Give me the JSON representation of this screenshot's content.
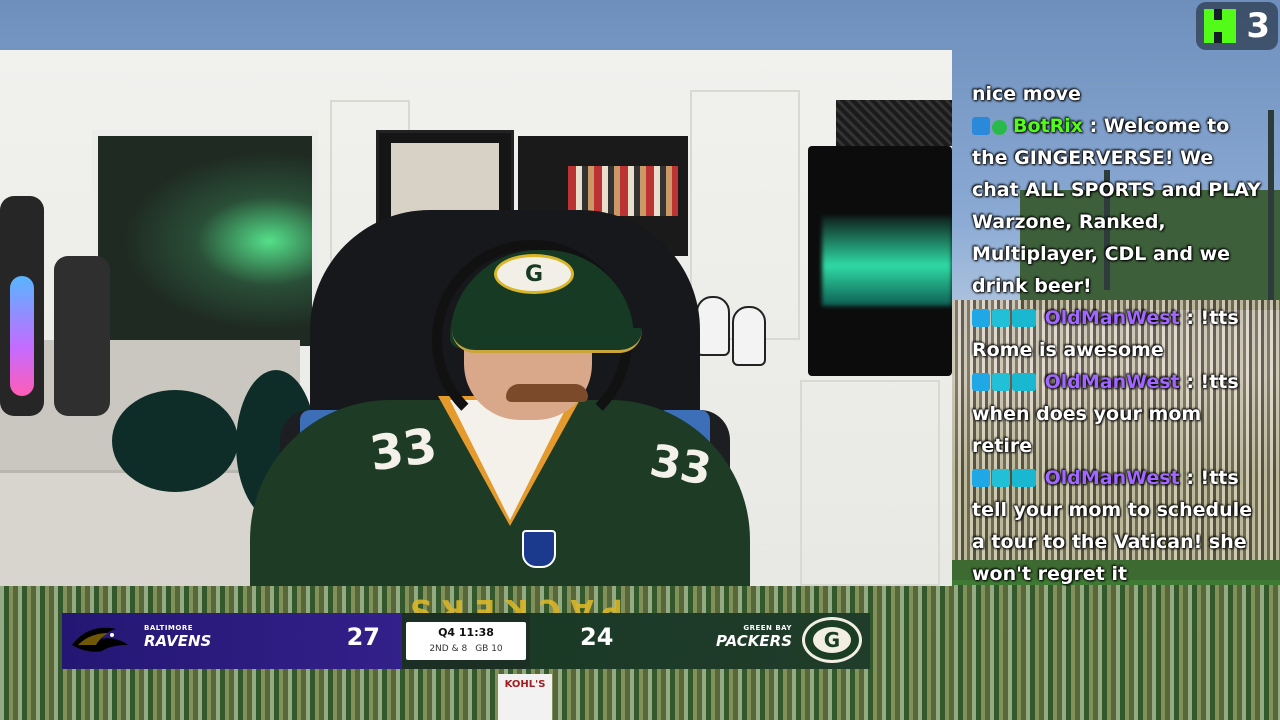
{
  "overlay": {
    "kick_viewer_count": "3"
  },
  "chat": {
    "messages": [
      {
        "text": "nice move"
      },
      {
        "user": "BotRix",
        "text": ": Welcome to the GINGERVERSE! We chat ALL SPORTS and PLAY Warzone, Ranked, Multiplayer, CDL and we drink beer!"
      },
      {
        "user": "OldManWest",
        "text": ": !tts Rome is awesome"
      },
      {
        "user": "OldManWest",
        "text": ": !tts when does your mom retire"
      },
      {
        "user": "OldManWest",
        "text": ": !tts tell your mom to schedule a tour to the Vatican! she won't regret it"
      }
    ],
    "colors": {
      "botrix": "#53fc18",
      "oldmanwest": "#a066ff"
    }
  },
  "scoreboard": {
    "away": {
      "city": "BALTIMORE",
      "name": "RAVENS",
      "score": "27",
      "color": "#241773"
    },
    "home": {
      "city": "GREEN BAY",
      "name": "PACKERS",
      "score": "24",
      "color": "#1a3a26"
    },
    "clock": {
      "quarter_time": "Q4 11:38",
      "down": "2ND & 8",
      "field": "GB 10"
    }
  },
  "scene": {
    "jersey_number": "33",
    "endzone_text": "PACKERS",
    "sideline_sign": "KOHL'S",
    "cap_logo": "G"
  }
}
